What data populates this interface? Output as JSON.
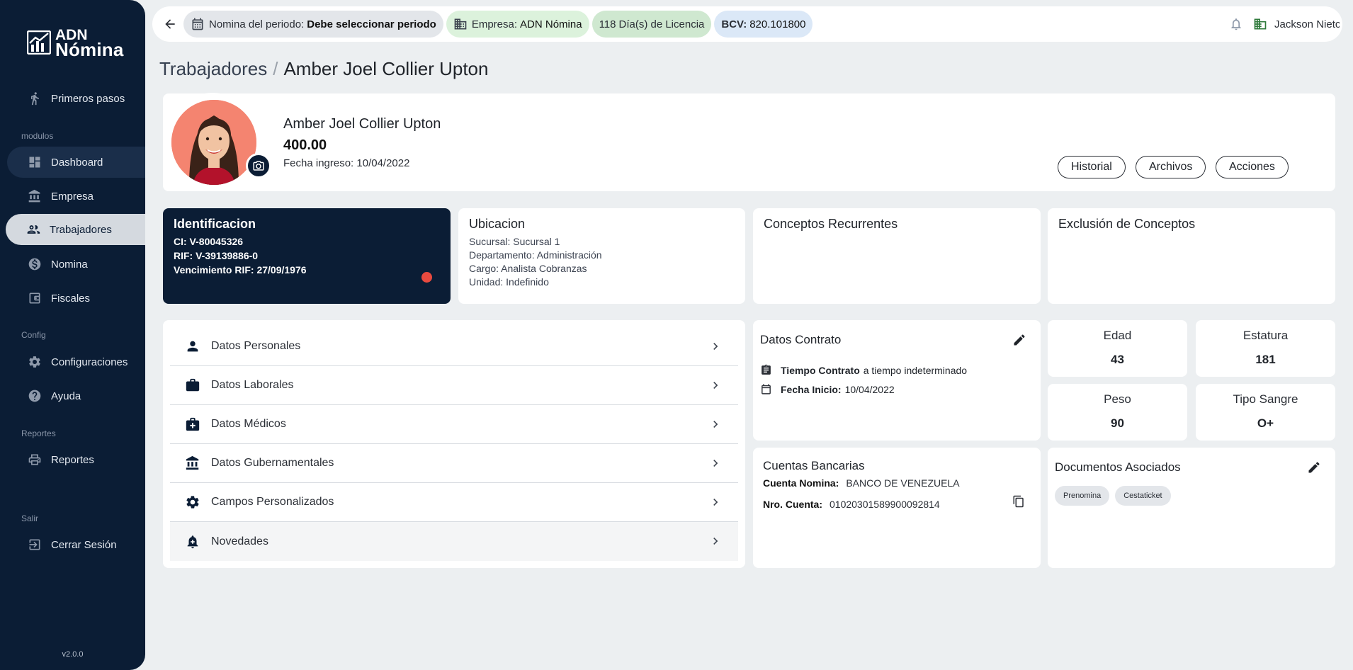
{
  "app": {
    "logo": {
      "line1": "ADN",
      "line2": "Nómina"
    },
    "version": "v2.0.0"
  },
  "sidebar": {
    "items": [
      {
        "label": "Primeros pasos",
        "icon": "walk-icon"
      },
      {
        "label": "Dashboard",
        "icon": "dashboard-icon"
      },
      {
        "label": "Empresa",
        "icon": "bank-icon"
      },
      {
        "label": "Trabajadores",
        "icon": "people-icon"
      },
      {
        "label": "Nomina",
        "icon": "dollar-icon"
      },
      {
        "label": "Fiscales",
        "icon": "wallet-icon"
      },
      {
        "label": "Configuraciones",
        "icon": "gear-icon"
      },
      {
        "label": "Ayuda",
        "icon": "help-icon"
      },
      {
        "label": "Reportes",
        "icon": "print-icon"
      },
      {
        "label": "Cerrar Sesión",
        "icon": "logout-icon"
      }
    ],
    "sections": {
      "modulos": "modulos",
      "config": "Config",
      "reportes": "Reportes",
      "salir": "Salir"
    }
  },
  "topbar": {
    "nomina_label": "Nomina del periodo:",
    "nomina_value": "Debe seleccionar periodo",
    "empresa_label": "Empresa:",
    "empresa_value": "ADN Nómina",
    "licencia_count": "118",
    "licencia_label": "Día(s) de Licencia",
    "bcv_label": "BCV:",
    "bcv_value": "820.101800",
    "user_name": "Jackson Nietc"
  },
  "breadcrumb": {
    "root": "Trabajadores",
    "sep": "/",
    "current": "Amber Joel Collier Upton"
  },
  "profile": {
    "name": "Amber Joel Collier Upton",
    "salary": "400.00",
    "ingreso": "Fecha ingreso: 10/04/2022",
    "buttons": {
      "historial": "Historial",
      "archivos": "Archivos",
      "acciones": "Acciones"
    }
  },
  "identificacion": {
    "title": "Identificacion",
    "ci": "CI: V-80045326",
    "rif": "RIF: V-39139886-0",
    "vencimiento": "Vencimiento RIF: 27/09/1976"
  },
  "ubicacion": {
    "title": "Ubicacion",
    "sucursal": "Sucursal: Sucursal 1",
    "departamento": "Departamento: Administración",
    "cargo": "Cargo: Analista Cobranzas",
    "unidad": "Unidad: Indefinido"
  },
  "conceptos": {
    "title": "Conceptos Recurrentes"
  },
  "exclusion": {
    "title": "Exclusión de Conceptos"
  },
  "menu": {
    "items": [
      {
        "label": "Datos Personales"
      },
      {
        "label": "Datos Laborales"
      },
      {
        "label": "Datos Médicos"
      },
      {
        "label": "Datos Gubernamentales"
      },
      {
        "label": "Campos Personalizados"
      },
      {
        "label": "Novedades"
      }
    ]
  },
  "contrato": {
    "title": "Datos Contrato",
    "tiempo_label": "Tiempo Contrato",
    "tiempo_value": "a tiempo indeterminado",
    "inicio_label": "Fecha Inicio:",
    "inicio_value": "10/04/2022"
  },
  "stats": {
    "edad": {
      "label": "Edad",
      "value": "43"
    },
    "estatura": {
      "label": "Estatura",
      "value": "181"
    },
    "peso": {
      "label": "Peso",
      "value": "90"
    },
    "sangre": {
      "label": "Tipo Sangre",
      "value": "O+"
    }
  },
  "cuentas": {
    "title": "Cuentas Bancarias",
    "nomina_label": "Cuenta Nomina:",
    "nomina_value": "BANCO DE VENEZUELA",
    "nro_label": "Nro. Cuenta:",
    "nro_value": "01020301589900092814"
  },
  "documentos": {
    "title": "Documentos Asociados",
    "tags": [
      "Prenomina",
      "Cestaticket"
    ]
  },
  "colors": {
    "navy": "#0b1d35",
    "alert": "#e84a3f",
    "background": "#eceff1"
  }
}
